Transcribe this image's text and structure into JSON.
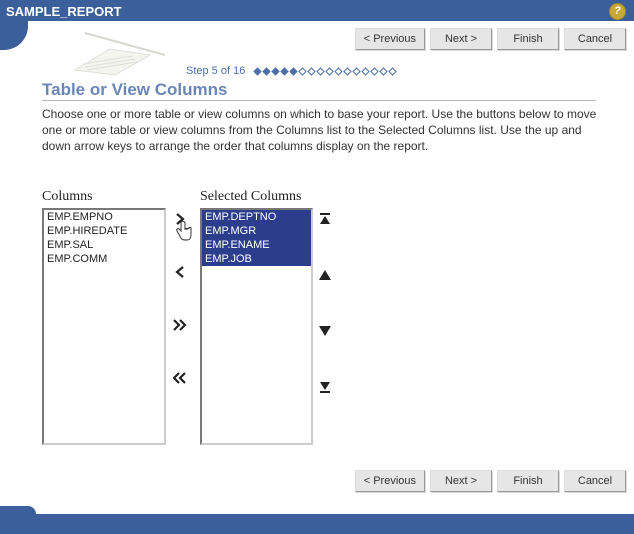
{
  "window": {
    "title": "SAMPLE_REPORT"
  },
  "nav": {
    "previous": "< Previous",
    "next": "Next >",
    "finish": "Finish",
    "cancel": "Cancel"
  },
  "step": {
    "label": "Step 5 of 16",
    "current": 5,
    "total": 16
  },
  "page": {
    "title": "Table or View Columns",
    "instructions": "Choose one or more table or view columns on which to base your report. Use the buttons below to move one or more table or view columns from the Columns list to the Selected Columns list. Use the up and down arrow keys to arrange the order that columns display on the report."
  },
  "labels": {
    "available": "Columns",
    "selected": "Selected Columns"
  },
  "available_columns": [
    "EMP.EMPNO",
    "EMP.HIREDATE",
    "EMP.SAL",
    "EMP.COMM"
  ],
  "selected_columns": [
    "EMP.DEPTNO",
    "EMP.MGR",
    "EMP.ENAME",
    "EMP.JOB"
  ]
}
